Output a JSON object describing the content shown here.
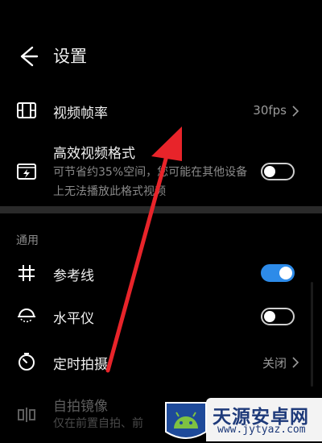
{
  "header": {
    "title": "设置"
  },
  "rows": {
    "frame_rate": {
      "label": "视频帧率",
      "value": "30fps"
    },
    "hevc": {
      "label": "高效视频格式",
      "sub": "可节省约35%空间，您可能在其他设备上无法播放此格式视频",
      "toggle_on": false
    },
    "section_general": "通用",
    "grid": {
      "label": "参考线",
      "toggle_on": true
    },
    "level": {
      "label": "水平仪",
      "toggle_on": false
    },
    "timer": {
      "label": "定时拍摄",
      "value": "关闭"
    },
    "mirror": {
      "label": "自拍镜像",
      "sub": "仅在前置自拍、前"
    }
  },
  "watermark": {
    "name": "天源安卓网",
    "url": "www.jytyaz.com"
  },
  "colors": {
    "accent": "#2d8be9",
    "background": "#000000",
    "arrow": "#e8242a"
  },
  "icons": {
    "back": "back-arrow-icon",
    "frame_rate": "film-icon",
    "hevc": "efficient-video-icon",
    "grid": "grid-icon",
    "level": "level-icon",
    "timer": "timer-icon",
    "mirror": "mirror-icon"
  }
}
